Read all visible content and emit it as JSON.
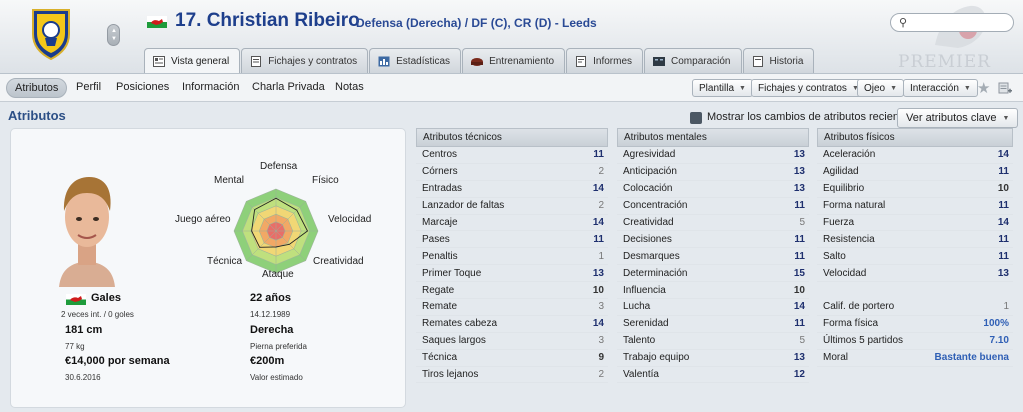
{
  "header": {
    "number_name": "17. Christian Ribeiro",
    "subtitle": "Defensa (Derecha) / DF (C), CR (D) - Leeds",
    "search_placeholder": "",
    "watermark": "PREMIER"
  },
  "tabs": [
    {
      "label": "Vista general",
      "icon": "overview-icon",
      "active": true
    },
    {
      "label": "Fichajes y contratos",
      "icon": "contract-icon",
      "active": false
    },
    {
      "label": "Estadísticas",
      "icon": "stats-icon",
      "active": false
    },
    {
      "label": "Entrenamiento",
      "icon": "training-icon",
      "active": false
    },
    {
      "label": "Informes",
      "icon": "report-icon",
      "active": false
    },
    {
      "label": "Comparación",
      "icon": "compare-icon",
      "active": false
    },
    {
      "label": "Historia",
      "icon": "history-icon",
      "active": false
    }
  ],
  "subnav": {
    "items": [
      "Atributos",
      "Perfil",
      "Posiciones",
      "Información",
      "Charla Privada",
      "Notas"
    ],
    "buttons": [
      "Plantilla",
      "Fichajes y contratos",
      "Ojeo",
      "Interacción"
    ]
  },
  "section": {
    "title": "Atributos",
    "checkbox_label": "Mostrar los cambios de atributos recientes",
    "key_button": "Ver atributos clave"
  },
  "radar": {
    "labels": [
      "Defensa",
      "Físico",
      "Velocidad",
      "Creatividad",
      "Ataque",
      "Técnica",
      "Juego aéreo",
      "Mental"
    ],
    "values": [
      0.78,
      0.7,
      0.75,
      0.45,
      0.38,
      0.55,
      0.58,
      0.72
    ]
  },
  "profile": {
    "nation": "Gales",
    "caps": "2 veces int. / 0 goles",
    "age": "22 años",
    "dob": "14.12.1989",
    "height": "181 cm",
    "weight": "77 kg",
    "foot": "Derecha",
    "foot_label": "Pierna preferida",
    "wage": "€14,000 por semana",
    "contract_end": "30.6.2016",
    "value": "€200m",
    "value_label": "Valor estimado"
  },
  "technical": {
    "title": "Atributos técnicos",
    "rows": [
      {
        "name": "Centros",
        "value": "11"
      },
      {
        "name": "Córners",
        "value": "2"
      },
      {
        "name": "Entradas",
        "value": "14"
      },
      {
        "name": "Lanzador de faltas",
        "value": "2"
      },
      {
        "name": "Marcaje",
        "value": "14"
      },
      {
        "name": "Pases",
        "value": "11"
      },
      {
        "name": "Penaltis",
        "value": "1"
      },
      {
        "name": "Primer Toque",
        "value": "13"
      },
      {
        "name": "Regate",
        "value": "10"
      },
      {
        "name": "Remate",
        "value": "3"
      },
      {
        "name": "Remates cabeza",
        "value": "14"
      },
      {
        "name": "Saques largos",
        "value": "3"
      },
      {
        "name": "Técnica",
        "value": "9"
      },
      {
        "name": "Tiros lejanos",
        "value": "2"
      }
    ]
  },
  "mental": {
    "title": "Atributos mentales",
    "rows": [
      {
        "name": "Agresividad",
        "value": "13"
      },
      {
        "name": "Anticipación",
        "value": "13"
      },
      {
        "name": "Colocación",
        "value": "13"
      },
      {
        "name": "Concentración",
        "value": "11"
      },
      {
        "name": "Creatividad",
        "value": "5"
      },
      {
        "name": "Decisiones",
        "value": "11"
      },
      {
        "name": "Desmarques",
        "value": "11"
      },
      {
        "name": "Determinación",
        "value": "15"
      },
      {
        "name": "Influencia",
        "value": "10"
      },
      {
        "name": "Lucha",
        "value": "14"
      },
      {
        "name": "Serenidad",
        "value": "11"
      },
      {
        "name": "Talento",
        "value": "5"
      },
      {
        "name": "Trabajo equipo",
        "value": "13"
      },
      {
        "name": "Valentía",
        "value": "12"
      }
    ]
  },
  "physical": {
    "title": "Atributos físicos",
    "rows": [
      {
        "name": "Aceleración",
        "value": "14"
      },
      {
        "name": "Agilidad",
        "value": "11"
      },
      {
        "name": "Equilibrio",
        "value": "10"
      },
      {
        "name": "Forma natural",
        "value": "11"
      },
      {
        "name": "Fuerza",
        "value": "14"
      },
      {
        "name": "Resistencia",
        "value": "11"
      },
      {
        "name": "Salto",
        "value": "11"
      },
      {
        "name": "Velocidad",
        "value": "13"
      }
    ],
    "extra": [
      {
        "name": "Calif. de portero",
        "value": "1"
      },
      {
        "name": "Forma física",
        "value": "100%"
      },
      {
        "name": "Últimos 5 partidos",
        "value": "7.10"
      },
      {
        "name": "Moral",
        "value": "Bastante buena"
      }
    ]
  }
}
